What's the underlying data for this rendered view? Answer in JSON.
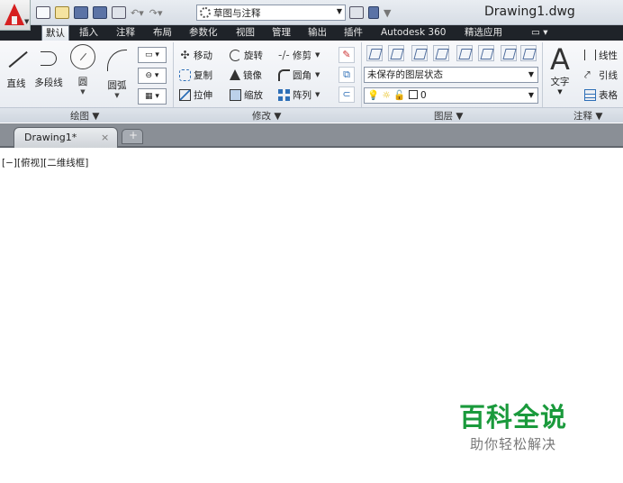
{
  "title_bar": {
    "workspace": "草图与注释",
    "document_title": "Drawing1.dwg"
  },
  "ribbon_tabs": [
    "默认",
    "插入",
    "注释",
    "布局",
    "参数化",
    "视图",
    "管理",
    "输出",
    "插件",
    "Autodesk 360",
    "精选应用"
  ],
  "draw_panel": {
    "title": "绘图 ▼",
    "tools": [
      "直线",
      "多段线",
      "圆",
      "圆弧"
    ]
  },
  "modify_panel": {
    "title": "修改 ▼",
    "row1": [
      "移动",
      "旋转",
      "修剪"
    ],
    "row2": [
      "复制",
      "镜像",
      "圆角"
    ],
    "row3": [
      "拉伸",
      "缩放",
      "阵列"
    ]
  },
  "layers_panel": {
    "title": "图层 ▼",
    "layer_state": "未保存的图层状态",
    "current_layer": "0"
  },
  "annotation_panel": {
    "title": "注释 ▼",
    "text_label": "文字",
    "items": [
      "线性",
      "引线",
      "表格"
    ]
  },
  "file_tabs": {
    "active": "Drawing1*",
    "close_symbol": "×"
  },
  "viewport": {
    "label": "[−][俯视][二维线框]"
  },
  "watermark": {
    "title": "百科全说",
    "subtitle": "助你轻松解决"
  }
}
